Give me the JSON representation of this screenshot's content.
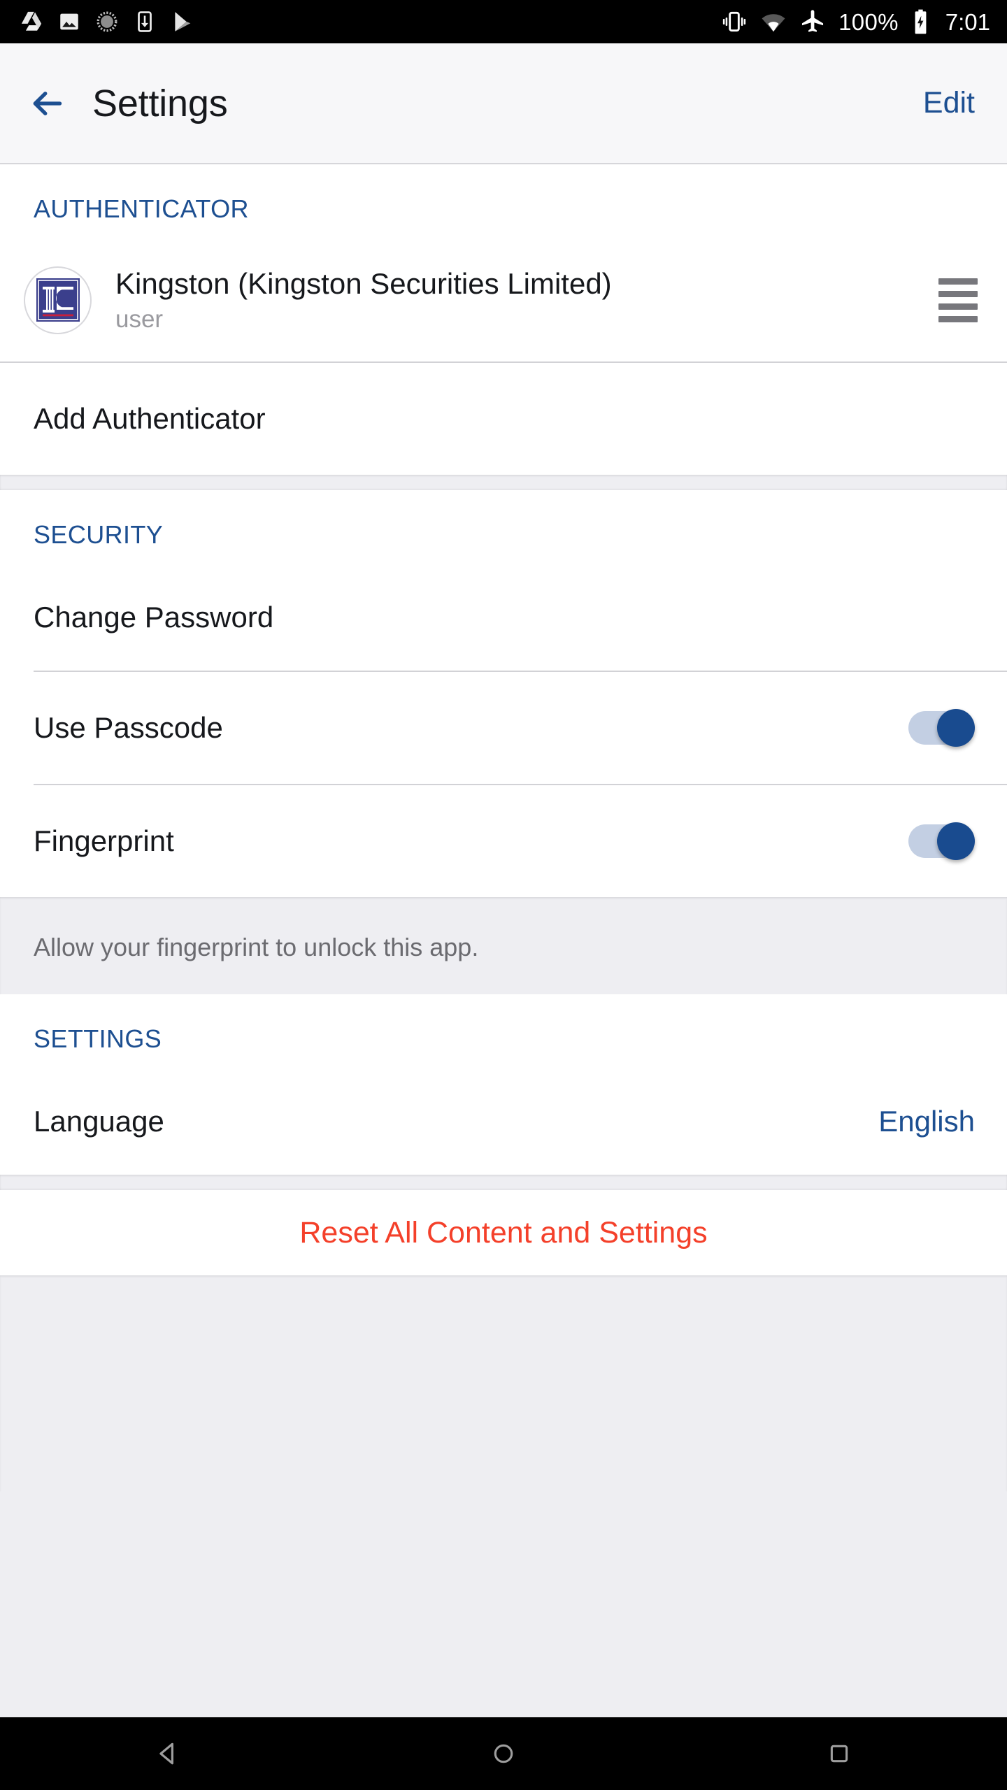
{
  "status_bar": {
    "left_icons": [
      "drive-icon",
      "photos-icon",
      "disc-icon",
      "download-icon",
      "play-store-icon"
    ],
    "right_icons": [
      "vibrate-icon",
      "wifi-icon",
      "airplane-mode-icon",
      "battery-charging-icon"
    ],
    "battery_percent": "100%",
    "time": "7:01"
  },
  "header": {
    "back_icon": "arrow-left-icon",
    "title": "Settings",
    "edit_label": "Edit"
  },
  "sections": {
    "authenticator": {
      "header": "AUTHENTICATOR",
      "account": {
        "name": "Kingston (Kingston Securities Limited)",
        "username": "user",
        "avatar_icon": "kingston-logo-icon",
        "drag_icon": "drag-handle-icon"
      },
      "add_label": "Add Authenticator"
    },
    "security": {
      "header": "SECURITY",
      "change_password_label": "Change Password",
      "use_passcode_label": "Use Passcode",
      "use_passcode_state": "on",
      "fingerprint_label": "Fingerprint",
      "fingerprint_state": "on",
      "footer_note": "Allow your fingerprint to unlock this app."
    },
    "settings": {
      "header": "SETTINGS",
      "language_label": "Language",
      "language_value": "English"
    },
    "reset": {
      "label": "Reset All Content and Settings"
    }
  },
  "nav_bar": {
    "back_icon": "nav-back-triangle-icon",
    "home_icon": "nav-home-circle-icon",
    "recents_icon": "nav-recents-square-icon"
  },
  "colors": {
    "accent_blue": "#1d4f91",
    "toggle_on": "#194b8f",
    "toggle_track": "#c3cfe3",
    "destructive_red": "#f4402a",
    "group_bg": "#eeeef2",
    "row_bg": "#ffffff",
    "muted_text": "#9a9a9f"
  }
}
